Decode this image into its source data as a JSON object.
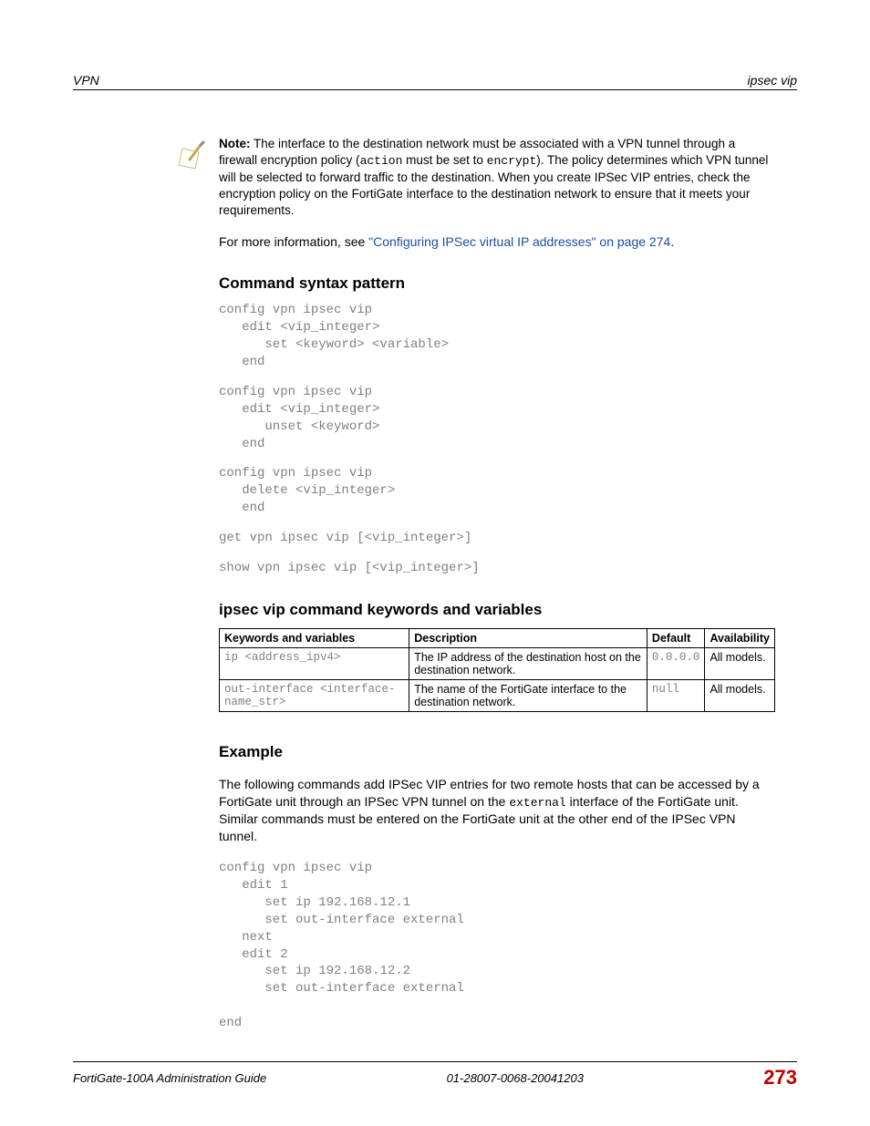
{
  "header": {
    "left": "VPN",
    "right": "ipsec vip"
  },
  "note": {
    "label": "Note:",
    "part1": " The interface to the destination network must be associated with a VPN tunnel through a firewall encryption policy (",
    "code1": "action",
    "part2": " must be set to ",
    "code2": "encrypt",
    "part3": "). The policy determines which VPN tunnel will be selected to forward traffic to the destination. When you create IPSec VIP entries, check the encryption policy on the FortiGate interface to the destination network to ensure that it meets your requirements."
  },
  "moreinfo": {
    "lead": "For more information, see ",
    "link": "\"Configuring IPSec virtual IP addresses\" on page 274",
    "trail": "."
  },
  "syntax": {
    "heading": "Command syntax pattern",
    "blocks": [
      "config vpn ipsec vip\n   edit <vip_integer>\n      set <keyword> <variable>\n   end",
      "config vpn ipsec vip\n   edit <vip_integer>\n      unset <keyword>\n   end",
      "config vpn ipsec vip\n   delete <vip_integer>\n   end",
      "get vpn ipsec vip [<vip_integer>]",
      "show vpn ipsec vip [<vip_integer>]"
    ]
  },
  "table": {
    "heading": "ipsec vip command keywords and variables",
    "headers": [
      "Keywords and variables",
      "Description",
      "Default",
      "Availability"
    ],
    "rows": [
      {
        "kw": "ip <address_ipv4>",
        "desc": "The IP address of the destination host on the destination network.",
        "def": "0.0.0.0",
        "avail": "All models."
      },
      {
        "kw": "out-interface <interface-name_str>",
        "desc": "The name of the FortiGate interface to the destination network.",
        "def": "null",
        "avail": "All models."
      }
    ]
  },
  "example": {
    "heading": "Example",
    "para_a": "The following commands add IPSec VIP entries for two remote hosts that can be accessed by a FortiGate unit through an IPSec VPN tunnel on the ",
    "para_code": "external",
    "para_b": " interface of the FortiGate unit. Similar commands must be entered on the FortiGate unit at the other end of the IPSec VPN tunnel.",
    "code": "config vpn ipsec vip\n   edit 1\n      set ip 192.168.12.1\n      set out-interface external\n   next\n   edit 2\n      set ip 192.168.12.2\n      set out-interface external\n\nend"
  },
  "footer": {
    "left": "FortiGate-100A Administration Guide",
    "mid": "01-28007-0068-20041203",
    "page": "273"
  }
}
